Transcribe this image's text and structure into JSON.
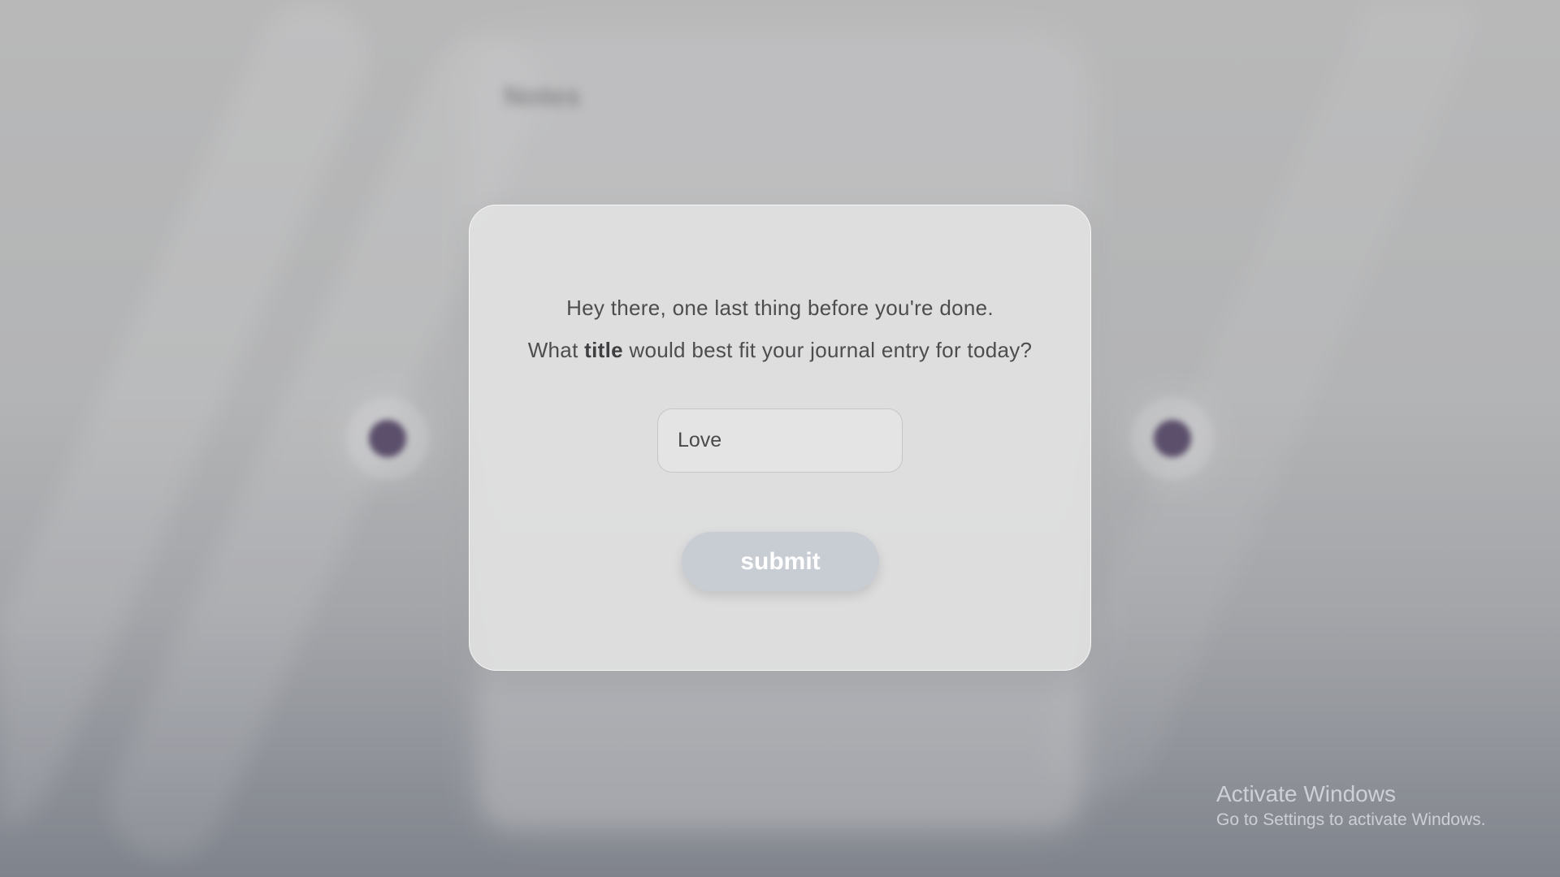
{
  "background": {
    "panel_title": "Notes"
  },
  "modal": {
    "prompt_line1": "Hey there, one last thing before you're done.",
    "prompt_line2_pre": "What ",
    "prompt_line2_bold": "title",
    "prompt_line2_post": " would best fit your journal entry for today?",
    "title_input_value": "Love",
    "submit_label": "submit"
  },
  "watermark": {
    "title": "Activate Windows",
    "subtitle": "Go to Settings to activate Windows."
  },
  "colors": {
    "modal_background": "#e2e2e3",
    "submit_button": "#c8ccd3",
    "dot": "#5b4f6b"
  }
}
